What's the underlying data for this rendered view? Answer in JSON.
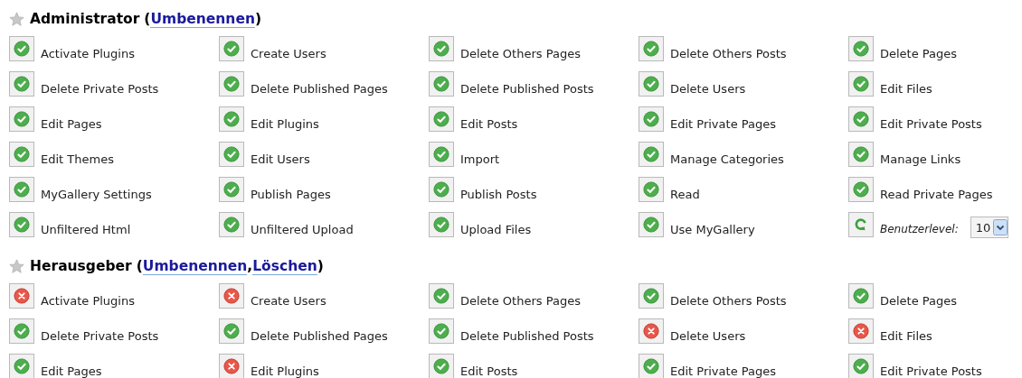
{
  "roles": [
    {
      "title": "Administrator",
      "heading_parts": [
        {
          "kind": "text",
          "text": "("
        },
        {
          "kind": "link",
          "text": "Umbenennen"
        },
        {
          "kind": "text",
          "text": ")"
        }
      ],
      "capabilities": [
        {
          "label": "Activate Plugins",
          "granted": true
        },
        {
          "label": "Create Users",
          "granted": true
        },
        {
          "label": "Delete Others Pages",
          "granted": true
        },
        {
          "label": "Delete Others Posts",
          "granted": true
        },
        {
          "label": "Delete Pages",
          "granted": true
        },
        {
          "label": "Delete Private Posts",
          "granted": true
        },
        {
          "label": "Delete Published Pages",
          "granted": true
        },
        {
          "label": "Delete Published Posts",
          "granted": true
        },
        {
          "label": "Delete Users",
          "granted": true
        },
        {
          "label": "Edit Files",
          "granted": true
        },
        {
          "label": "Edit Pages",
          "granted": true
        },
        {
          "label": "Edit Plugins",
          "granted": true
        },
        {
          "label": "Edit Posts",
          "granted": true
        },
        {
          "label": "Edit Private Pages",
          "granted": true
        },
        {
          "label": "Edit Private Posts",
          "granted": true
        },
        {
          "label": "Edit Themes",
          "granted": true
        },
        {
          "label": "Edit Users",
          "granted": true
        },
        {
          "label": "Import",
          "granted": true
        },
        {
          "label": "Manage Categories",
          "granted": true
        },
        {
          "label": "Manage Links",
          "granted": true
        },
        {
          "label": "MyGallery Settings",
          "granted": true
        },
        {
          "label": "Publish Pages",
          "granted": true
        },
        {
          "label": "Publish Posts",
          "granted": true
        },
        {
          "label": "Read",
          "granted": true
        },
        {
          "label": "Read Private Pages",
          "granted": true
        },
        {
          "label": "Unfiltered Html",
          "granted": true
        },
        {
          "label": "Unfiltered Upload",
          "granted": true
        },
        {
          "label": "Upload Files",
          "granted": true
        },
        {
          "label": "Use MyGallery",
          "granted": true
        }
      ],
      "user_level": {
        "label": "Benutzerlevel:",
        "value": "10"
      }
    },
    {
      "title": "Herausgeber",
      "heading_parts": [
        {
          "kind": "text",
          "text": "("
        },
        {
          "kind": "link",
          "text": "Umbenennen"
        },
        {
          "kind": "text",
          "text": ","
        },
        {
          "kind": "link",
          "text": "Löschen"
        },
        {
          "kind": "text",
          "text": ")"
        }
      ],
      "capabilities": [
        {
          "label": "Activate Plugins",
          "granted": false
        },
        {
          "label": "Create Users",
          "granted": false
        },
        {
          "label": "Delete Others Pages",
          "granted": true
        },
        {
          "label": "Delete Others Posts",
          "granted": true
        },
        {
          "label": "Delete Pages",
          "granted": true
        },
        {
          "label": "Delete Private Posts",
          "granted": true
        },
        {
          "label": "Delete Published Pages",
          "granted": true
        },
        {
          "label": "Delete Published Posts",
          "granted": true
        },
        {
          "label": "Delete Users",
          "granted": false
        },
        {
          "label": "Edit Files",
          "granted": false
        },
        {
          "label": "Edit Pages",
          "granted": true
        },
        {
          "label": "Edit Plugins",
          "granted": false
        },
        {
          "label": "Edit Posts",
          "granted": true
        },
        {
          "label": "Edit Private Pages",
          "granted": true
        },
        {
          "label": "Edit Private Posts",
          "granted": true
        }
      ]
    }
  ]
}
